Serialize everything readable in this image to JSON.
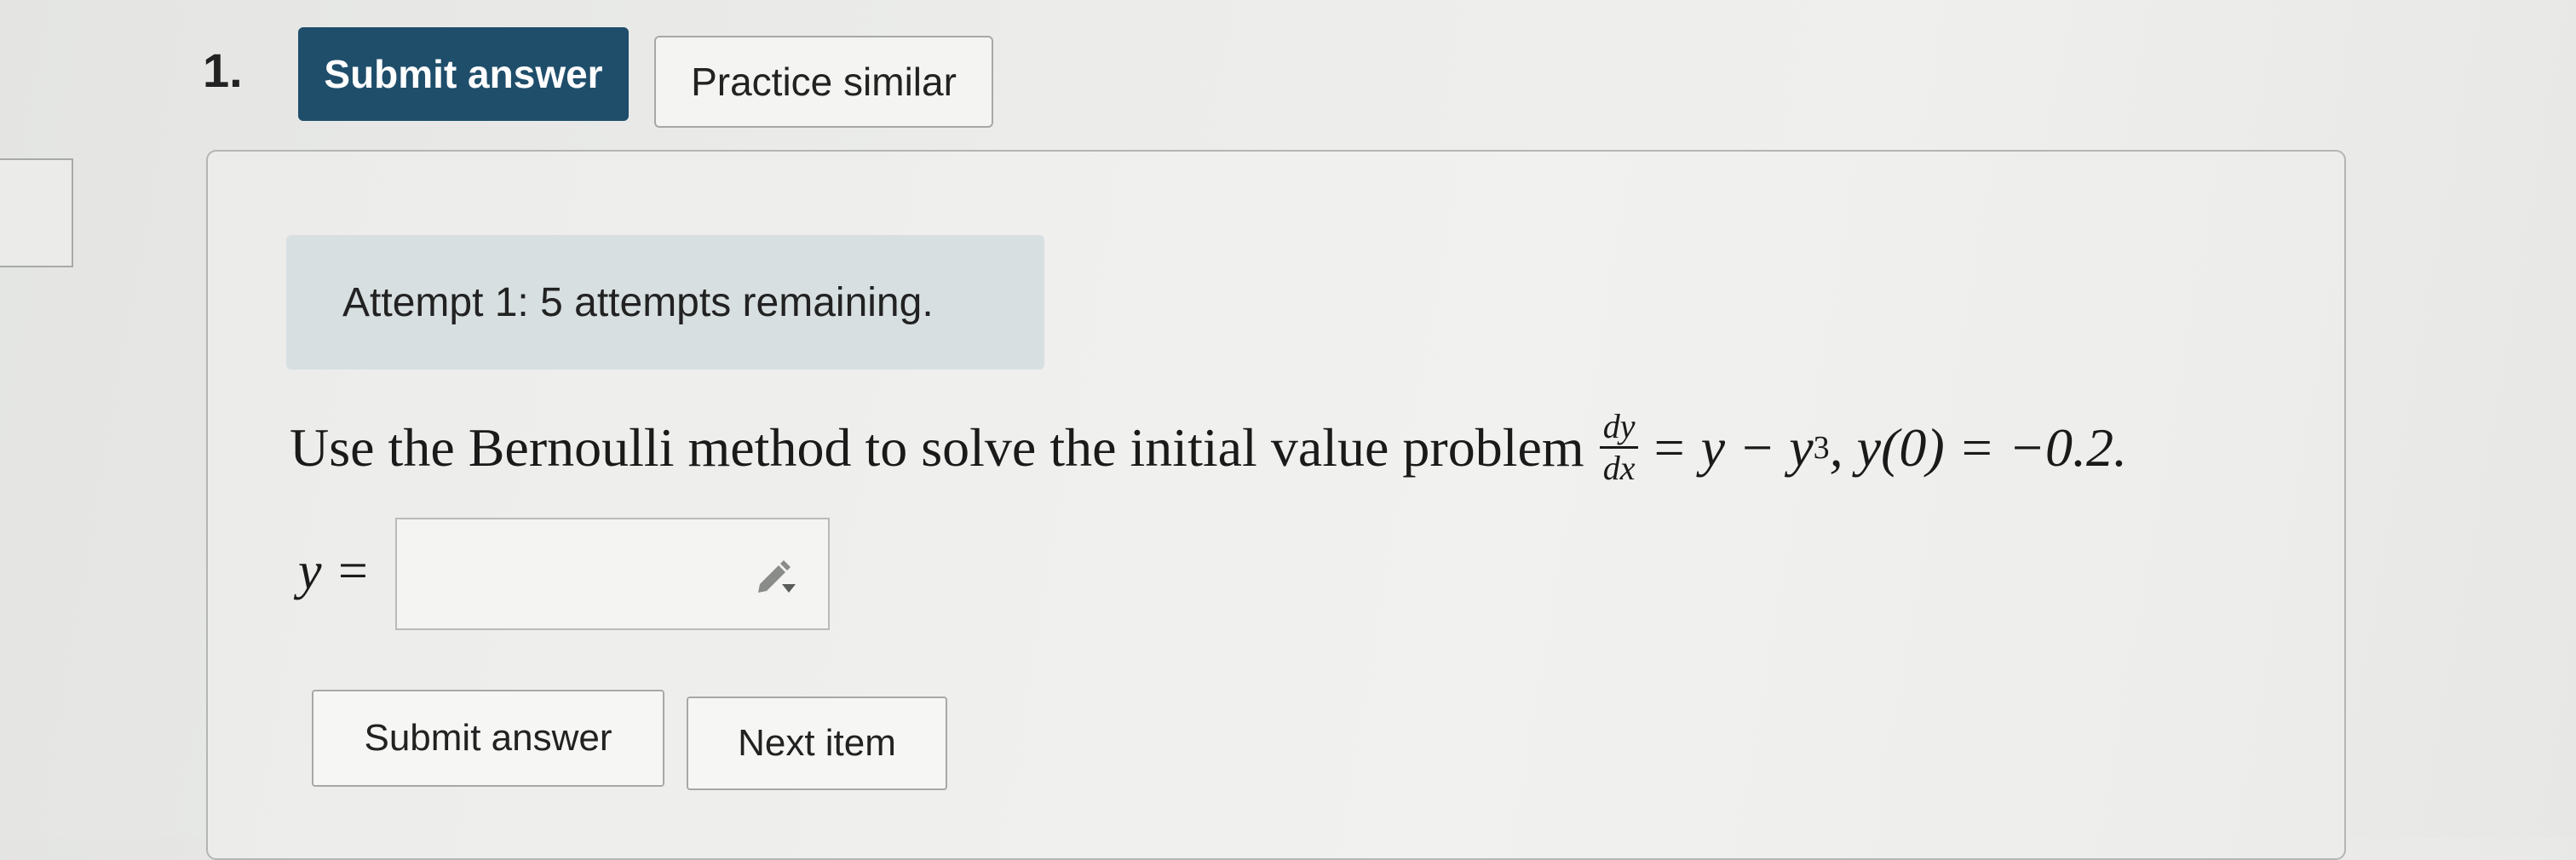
{
  "question": {
    "number": "1."
  },
  "toolbar": {
    "submit_label": "Submit answer",
    "practice_label": "Practice similar"
  },
  "attempt": {
    "text": "Attempt 1: 5 attempts remaining."
  },
  "problem": {
    "prefix": "Use the Bernoulli method to solve the initial value problem",
    "frac_num": "dy",
    "frac_den": "dx",
    "eq_part1": "= y − y",
    "exponent": "3",
    "eq_part2": ", y(0) = −0.2."
  },
  "answer": {
    "label": "y =",
    "value": "",
    "editor_icon": "pencil-icon"
  },
  "footer": {
    "submit_label": "Submit answer",
    "next_label": "Next item"
  },
  "colors": {
    "primary_button": "#1f4e6b",
    "attempt_background": "#d8dfe1"
  }
}
